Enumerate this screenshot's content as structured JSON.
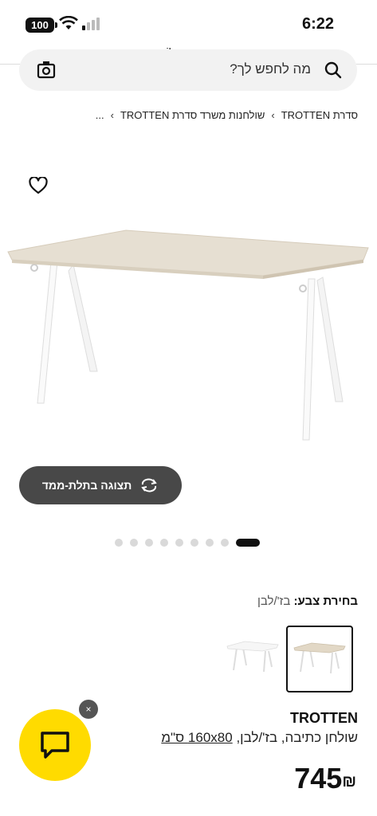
{
  "status_bar": {
    "battery": "100",
    "time": "6:22"
  },
  "browser": {
    "url": "ikea.com"
  },
  "search": {
    "placeholder": "מה לחפש לך?"
  },
  "breadcrumb": {
    "items": [
      "סדרת TROTTEN",
      "שולחנות משרד סדרת TROTTEN",
      "..."
    ]
  },
  "gallery": {
    "view_3d_label": "תצוגה בתלת-ממד",
    "dot_count": 9,
    "active_index": 0
  },
  "color_choice": {
    "label": "בחירת צבע:",
    "value": "בז'/לבן",
    "options": [
      "beige-white",
      "white"
    ],
    "selected_index": 0
  },
  "product": {
    "name": "TROTTEN",
    "description": "שולחן כתיבה, בז'/לבן,",
    "size": "160x80 ס\"מ",
    "price": "745",
    "currency": "₪"
  },
  "chat": {
    "close_label": "×"
  },
  "colors": {
    "chat_yellow": "#ffdb00",
    "button_dark": "#484848",
    "tabletop": "#e6dfd2"
  }
}
